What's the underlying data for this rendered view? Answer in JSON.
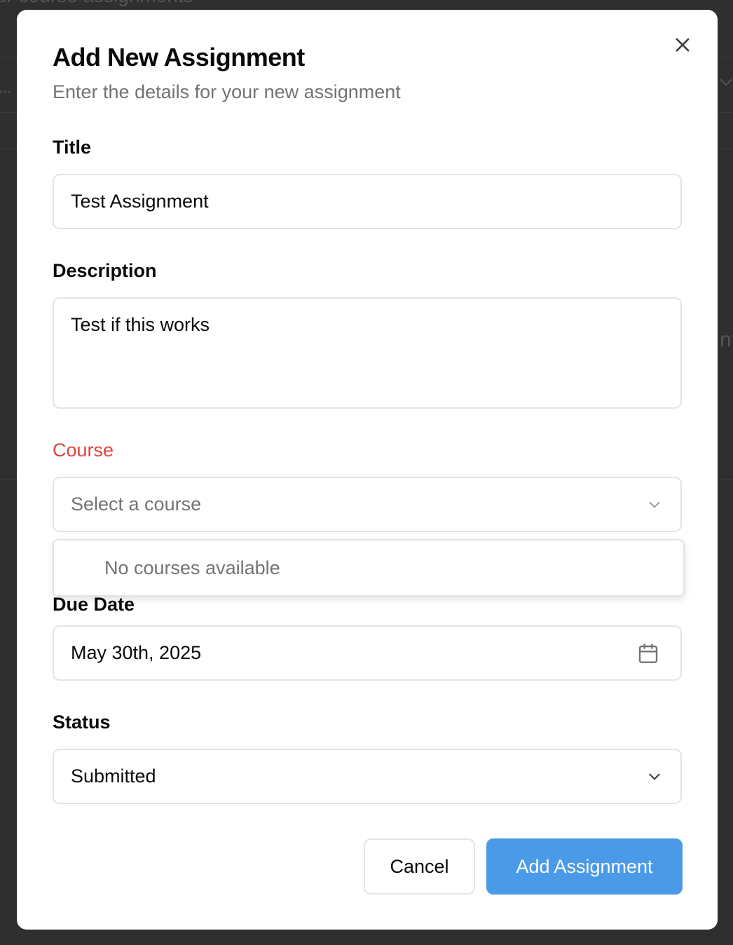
{
  "background": {
    "header_fragment": "ur course assignments",
    "dots": "...",
    "side_fragment": "nt"
  },
  "dialog": {
    "title": "Add New Assignment",
    "subtitle": "Enter the details for your new assignment",
    "close_icon": "close-icon"
  },
  "form": {
    "title_label": "Title",
    "title_value": "Test Assignment",
    "description_label": "Description",
    "description_value": "Test if this works",
    "course_label": "Course",
    "course_placeholder": "Select a course",
    "course_options_empty": "No courses available",
    "due_date_label": "Due Date",
    "due_date_value": "May 30th, 2025",
    "status_label": "Status",
    "status_value": "Submitted"
  },
  "actions": {
    "cancel_label": "Cancel",
    "submit_label": "Add Assignment"
  },
  "colors": {
    "accent": "#4a9ae8",
    "error": "#e0443f",
    "muted_text": "#737373",
    "border": "#e4e4e7"
  }
}
